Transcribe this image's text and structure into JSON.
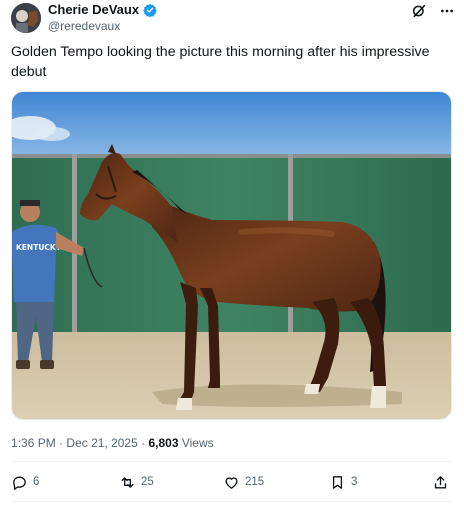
{
  "author": {
    "display_name": "Cherie DeVaux",
    "handle": "@reredevaux"
  },
  "header_icons": [
    "grok-icon",
    "more-icon"
  ],
  "tweet": {
    "text": "Golden Tempo looking the picture this morning after his impressive debut",
    "shirt_text": "KENTUCKY"
  },
  "meta": {
    "time": "1:36 PM",
    "separator": "·",
    "date": "Dec 21, 2025",
    "views_count": "6,803",
    "views_label": "Views"
  },
  "actions": {
    "replies": "6",
    "reposts": "25",
    "likes": "215",
    "bookmarks": "3"
  },
  "colors": {
    "verified": "#1d9bf0",
    "text": "#0f1419",
    "secondary": "#536471",
    "fence": "#3e7a5c",
    "sky": "#6aa3d8",
    "horse": "#5a2d18"
  }
}
